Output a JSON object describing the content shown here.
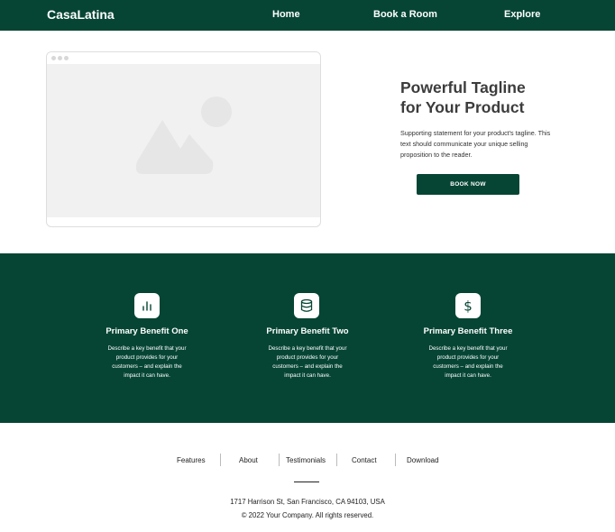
{
  "colors": {
    "brand": "#064534",
    "placeholder": "#e6e6e6"
  },
  "nav": {
    "brand": "CasaLatina",
    "links": [
      "Home",
      "Book a Room",
      "Explore"
    ]
  },
  "hero": {
    "image_icon": "image-placeholder-icon",
    "tagline_line1": "Powerful Tagline",
    "tagline_line2": "for Your Product",
    "support": "Supporting statement for your product's tagline. This text should communicate your unique selling proposition to the reader.",
    "cta": "BOOK NOW"
  },
  "benefits": [
    {
      "icon": "bar-chart-icon",
      "title": "Primary Benefit One",
      "text": "Describe a key benefit that your product provides for your customers – and explain the impact it can have."
    },
    {
      "icon": "database-icon",
      "title": "Primary Benefit Two",
      "text": "Describe a key benefit that your product provides for your customers – and explain the impact it can have."
    },
    {
      "icon": "dollar-icon",
      "title": "Primary Benefit Three",
      "text": "Describe a key benefit that your product provides for your customers – and explain the impact it can have."
    }
  ],
  "footer": {
    "links": [
      "Features",
      "About",
      "Testimonials",
      "Contact",
      "Download"
    ],
    "address": "1717 Harrison St, San Francisco, CA 94103, USA",
    "copyright": "© 2022 Your Company.  All rights reserved."
  }
}
